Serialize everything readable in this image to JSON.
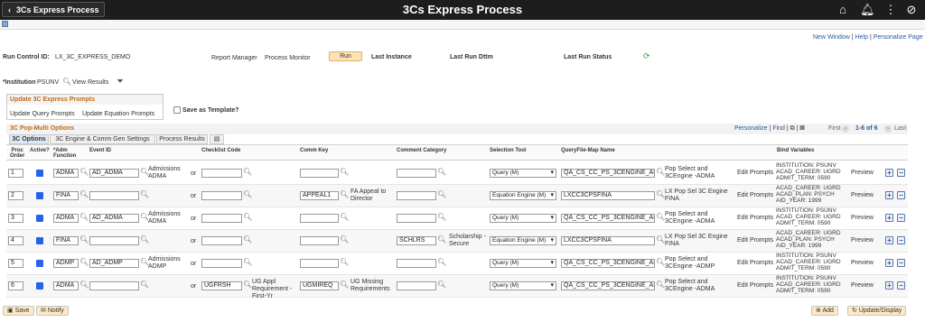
{
  "topbar": {
    "back_label": "3Cs Express Process",
    "title": "3Cs Express Process"
  },
  "links": {
    "new_window": "New Window",
    "help": "Help",
    "personalize_page": "Personalize Page",
    "sep": "|"
  },
  "run_control": {
    "label": "Run Control ID:",
    "value": "LX_3C_EXPRESS_DEMO",
    "report_manager": "Report Manager",
    "process_monitor": "Process Monitor",
    "run": "Run",
    "last_instance": "Last Instance",
    "last_run_dttm": "Last Run Dttm",
    "last_run_status": "Last Run Status"
  },
  "institution": {
    "label": "*Institution",
    "value": "PSUNV",
    "view_results": "View Results"
  },
  "prompts": {
    "header": "Update 3C Express Prompts",
    "query": "Update Query Prompts",
    "equation": "Update Equation Prompts",
    "save_template": "Save as Template?"
  },
  "grid": {
    "title": "3C Pop-Multi Options",
    "personalize": "Personalize",
    "find": "Find",
    "first": "First",
    "range": "1-6 of 6",
    "last": "Last",
    "bar": "|",
    "tabs": [
      "3C Options",
      "3C Engine & Comm Gen Settings",
      "Process Results"
    ],
    "headers": {
      "order": "Proc\nOrder",
      "active": "Active?",
      "func": "*Adm\nFunction",
      "event": "Event ID",
      "checklist": "Checklist Code",
      "commkey": "Comm Key",
      "category": "Comment Category",
      "tool": "Selection Tool",
      "query": "QueryFile-Map Name",
      "bind": "Bind Variables"
    },
    "rows": [
      {
        "order": "1",
        "func": "ADMA",
        "event": "AD_ADMA",
        "event_link": "Admissions ADMA",
        "or": "or",
        "checklist": "",
        "checklist_link": "",
        "commkey": "",
        "commkey_link": "",
        "category": "",
        "category_link": "",
        "tool": "Query (M)",
        "query": "QA_CS_CC_PS_3CENGINE_AD",
        "desc": "Pop Select and 3CEngine -ADMA",
        "edit": "Edit Prompts",
        "bind": "INSTITUTION: PSUNV ACAD_CAREER: UGRD ADMIT_TERM: 0590",
        "preview": "Preview",
        "plus": "+",
        "minus": "−"
      },
      {
        "order": "2",
        "func": "FINA",
        "event": "",
        "event_link": "",
        "or": "or",
        "checklist": "",
        "checklist_link": "",
        "commkey": "APPEAL1",
        "commkey_link": "FA Appeal to Director",
        "category": "",
        "category_link": "",
        "tool": "Equation Engine (M)",
        "query": "LXCC3CPSFINA",
        "desc": "LX Pop Sel 3C Engine FINA",
        "edit": "Edit Prompts",
        "bind": "ACAD_CAREER: UGRD ACAD_PLAN: PSYCH AID_YEAR: 1999",
        "preview": "Preview",
        "plus": "+",
        "minus": "−"
      },
      {
        "order": "3",
        "func": "ADMA",
        "event": "AD_ADMA",
        "event_link": "Admissions ADMA",
        "or": "or",
        "checklist": "",
        "checklist_link": "",
        "commkey": "",
        "commkey_link": "",
        "category": "",
        "category_link": "",
        "tool": "Query (M)",
        "query": "QA_CS_CC_PS_3CENGINE_AD",
        "desc": "Pop Select and 3CEngine -ADMA",
        "edit": "Edit Prompts",
        "bind": "INSTITUTION: PSUNV ACAD_CAREER: UGRD ADMIT_TERM: 0590",
        "preview": "Preview",
        "plus": "+",
        "minus": "−"
      },
      {
        "order": "4",
        "func": "FINA",
        "event": "",
        "event_link": "",
        "or": "or",
        "checklist": "",
        "checklist_link": "",
        "commkey": "",
        "commkey_link": "",
        "category": "SCHLRS",
        "category_link": "Scholarship - Secure",
        "tool": "Equation Engine (M)",
        "query": "LXCC3CPSFINA",
        "desc": "LX Pop Sel 3C Engine FINA",
        "edit": "Edit Prompts",
        "bind": "ACAD_CAREER: UGRD ACAD_PLAN: PSYCH AID_YEAR: 1999",
        "preview": "Preview",
        "plus": "+",
        "minus": "−"
      },
      {
        "order": "5",
        "func": "ADMP",
        "event": "AD_ADMP",
        "event_link": "Admissions ADMP",
        "or": "or",
        "checklist": "",
        "checklist_link": "",
        "commkey": "",
        "commkey_link": "",
        "category": "",
        "category_link": "",
        "tool": "Query (M)",
        "query": "QA_CS_CC_PS_3CENGINE_AD",
        "desc": "Pop Select and 3CEngine -ADMP",
        "edit": "Edit Prompts",
        "bind": "INSTITUTION: PSUNV ACAD_CAREER: UGRD ADMIT_TERM: 0590",
        "preview": "Preview",
        "plus": "+",
        "minus": "−"
      },
      {
        "order": "6",
        "func": "ADMA",
        "event": "",
        "event_link": "",
        "or": "or",
        "checklist": "UGFRSH",
        "checklist_link": "UG Appl Requirement - First-Yr",
        "commkey": "UGMIREQ",
        "commkey_link": "UG Missing Requirements",
        "category": "",
        "category_link": "",
        "tool": "Query (M)",
        "query": "QA_CS_CC_PS_3CENGINE_AD",
        "desc": "Pop Select and 3CEngine -ADMA",
        "edit": "Edit Prompts",
        "bind": "INSTITUTION: PSUNV ACAD_CAREER: UGRD ADMIT_TERM: 0590",
        "preview": "Preview",
        "plus": "+",
        "minus": "−"
      }
    ]
  },
  "bottom": {
    "save": "Save",
    "notify": "Notify",
    "add": "Add",
    "update": "Update/Display"
  }
}
